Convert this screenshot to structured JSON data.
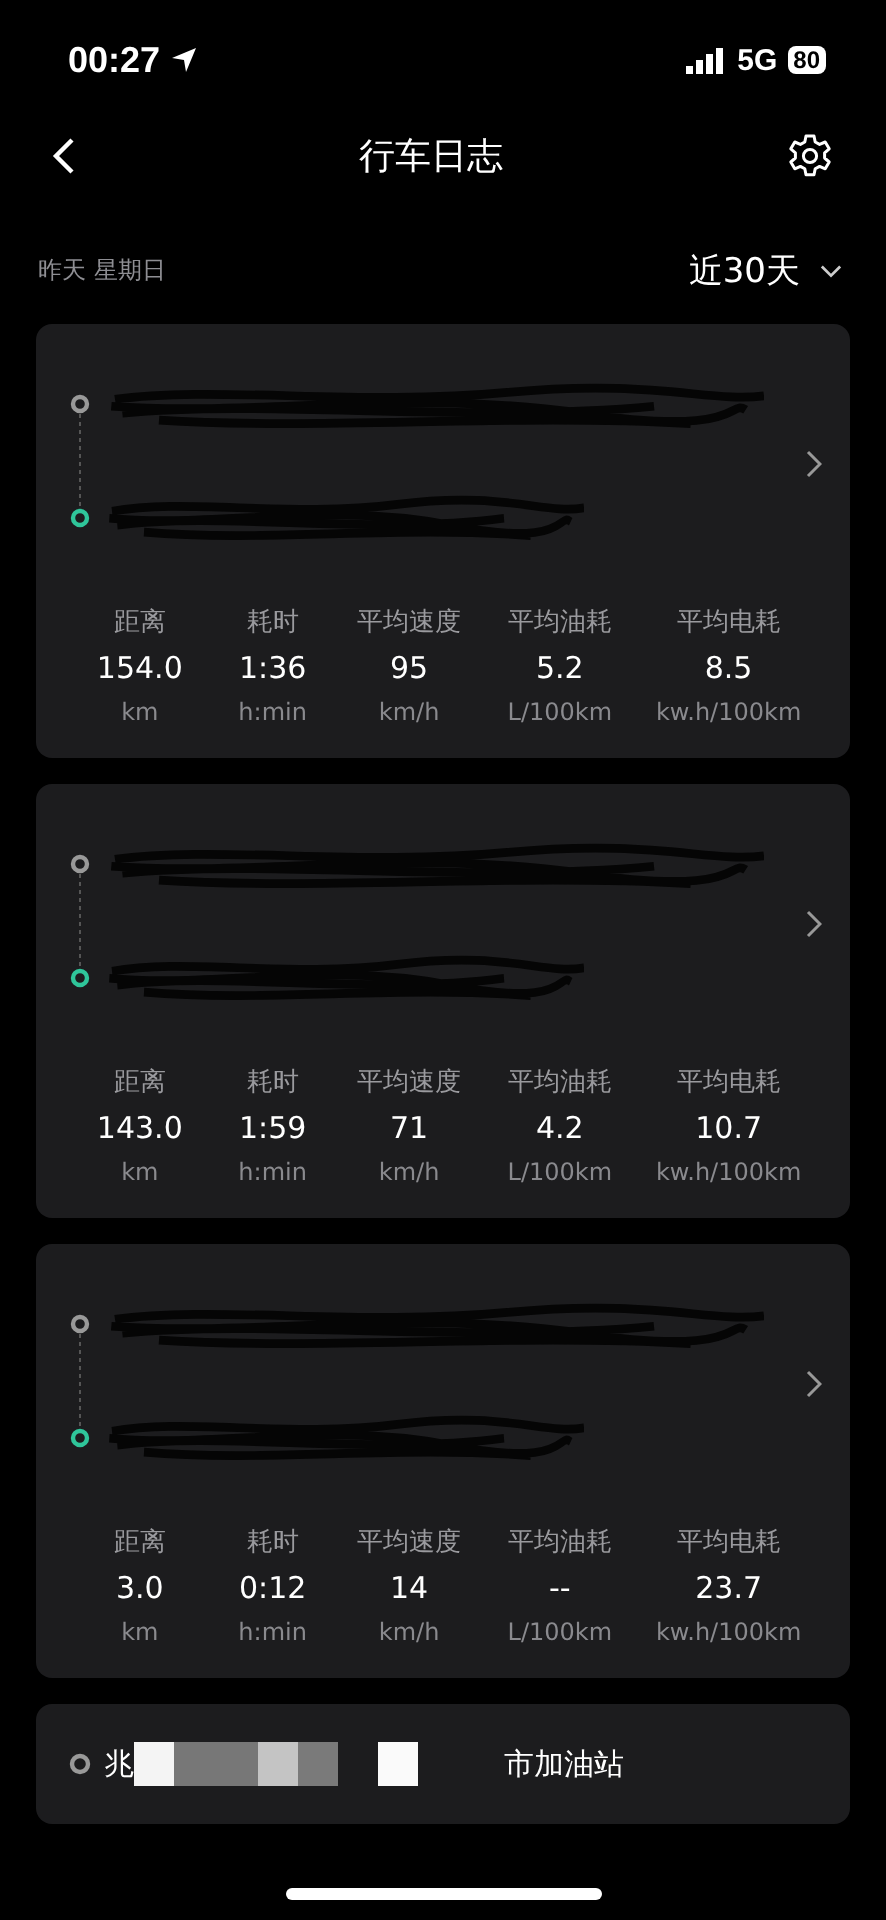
{
  "status_bar": {
    "time": "00:27",
    "network": "5G",
    "battery": "80"
  },
  "nav": {
    "title": "行车日志"
  },
  "filter": {
    "date": "昨天 星期日",
    "range": "近30天"
  },
  "trips": [
    {
      "stats": [
        {
          "label": "距离",
          "value": "154.0",
          "unit": "km"
        },
        {
          "label": "耗时",
          "value": "1:36",
          "unit": "h:min"
        },
        {
          "label": "平均速度",
          "value": "95",
          "unit": "km/h"
        },
        {
          "label": "平均油耗",
          "value": "5.2",
          "unit": "L/100km"
        },
        {
          "label": "平均电耗",
          "value": "8.5",
          "unit": "kw.h/100km"
        }
      ]
    },
    {
      "stats": [
        {
          "label": "距离",
          "value": "143.0",
          "unit": "km"
        },
        {
          "label": "耗时",
          "value": "1:59",
          "unit": "h:min"
        },
        {
          "label": "平均速度",
          "value": "71",
          "unit": "km/h"
        },
        {
          "label": "平均油耗",
          "value": "4.2",
          "unit": "L/100km"
        },
        {
          "label": "平均电耗",
          "value": "10.7",
          "unit": "kw.h/100km"
        }
      ]
    },
    {
      "stats": [
        {
          "label": "距离",
          "value": "3.0",
          "unit": "km"
        },
        {
          "label": "耗时",
          "value": "0:12",
          "unit": "h:min"
        },
        {
          "label": "平均速度",
          "value": "14",
          "unit": "km/h"
        },
        {
          "label": "平均油耗",
          "value": "--",
          "unit": "L/100km"
        },
        {
          "label": "平均电耗",
          "value": "23.7",
          "unit": "kw.h/100km"
        }
      ]
    }
  ],
  "partial_trip": {
    "start_prefix": "兆",
    "start_suffix": "市加油站"
  }
}
